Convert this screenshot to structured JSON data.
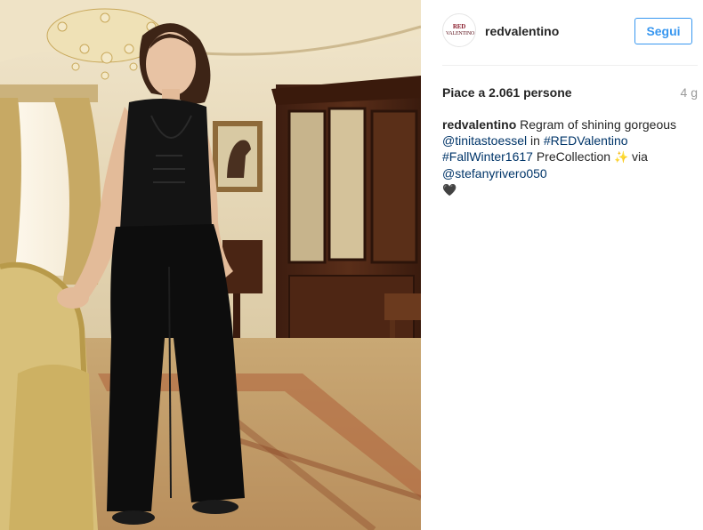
{
  "post": {
    "username": "redvalentino",
    "avatar_logo": {
      "line1": "RED",
      "line2": "VALENTINO"
    },
    "follow_label": "Segui",
    "likes_text": "Piace a 2.061 persone",
    "age": "4 g",
    "caption": {
      "username": "redvalentino",
      "text1": " Regram of shining gorgeous ",
      "mention1": "@tinitastoessel",
      "text2": " in ",
      "hashtag1": "#REDValentino",
      "text3": " ",
      "hashtag2": "#FallWinter1617",
      "text4": " PreCollection ",
      "sparkle_emoji": "✨",
      "text5": " via ",
      "mention2": "@stefanyrivero050",
      "heart_emoji": "🖤"
    }
  },
  "photo": {
    "description_icon": "photo-woman-black-outfit",
    "colors": {
      "wall": "#e9dcc0",
      "carpet": "#c9a874",
      "wardrobe": "#4a2514",
      "outfit": "#111111",
      "chair": "#d8c07a"
    }
  },
  "colors": {
    "accent": "#3897f0",
    "link": "#003569",
    "muted": "#999999"
  }
}
